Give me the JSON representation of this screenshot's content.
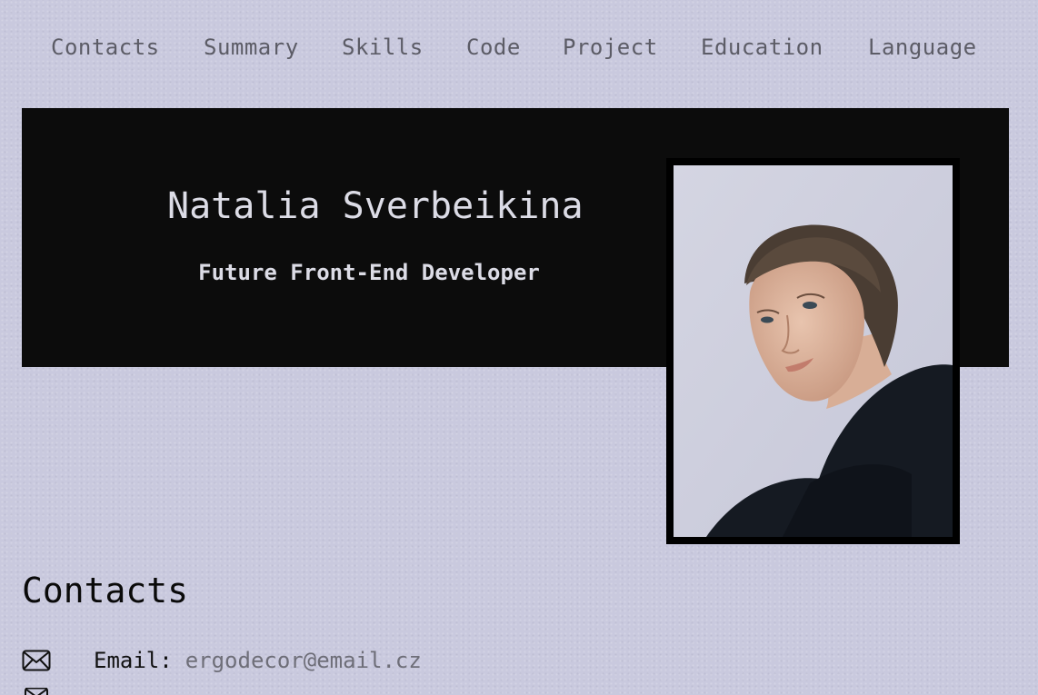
{
  "nav": {
    "items": [
      "Contacts",
      "Summary",
      "Skills",
      "Code",
      "Project",
      "Education",
      "Language"
    ]
  },
  "hero": {
    "name": "Natalia Sverbeikina",
    "role": "Future Front-End Developer",
    "photo_icon": "portrait-photo"
  },
  "contacts": {
    "title": "Contacts",
    "email_label": "Email:",
    "email_value": "ergodecor@email.cz",
    "email_icon": "envelope-icon"
  },
  "colors": {
    "background": "#c9c9de",
    "hero_background": "#0c0c0c",
    "hero_text": "#dcdce6",
    "nav_text": "#5c5c66"
  }
}
